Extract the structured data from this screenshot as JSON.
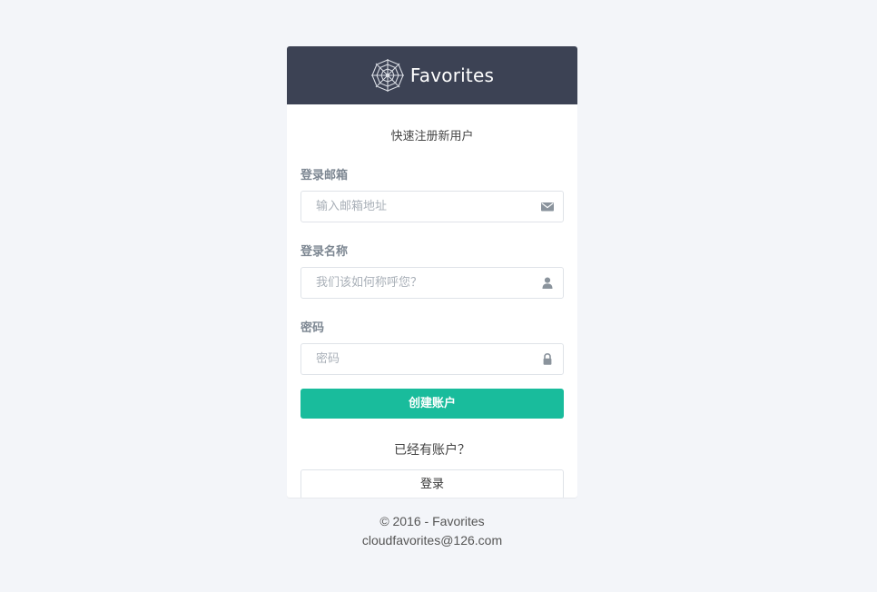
{
  "header": {
    "logo_icon": "spiderweb-logo-icon",
    "brand": "Favorites",
    "background_color": "#3c4254"
  },
  "form": {
    "subtitle": "快速注册新用户",
    "email": {
      "label": "登录邮箱",
      "placeholder": "输入邮箱地址",
      "value": "",
      "icon": "envelope-icon"
    },
    "name": {
      "label": "登录名称",
      "placeholder": "我们该如何称呼您？",
      "value": "",
      "icon": "user-icon"
    },
    "password": {
      "label": "密码",
      "placeholder": "密码",
      "value": "",
      "icon": "lock-icon"
    },
    "submit_label": "创建账户",
    "submit_color": "#19bc9c",
    "have_account_text": "已经有账户？",
    "login_label": "登录"
  },
  "footer": {
    "copyright": "© 2016 - Favorites",
    "email": "cloudfavorites@126.com"
  }
}
